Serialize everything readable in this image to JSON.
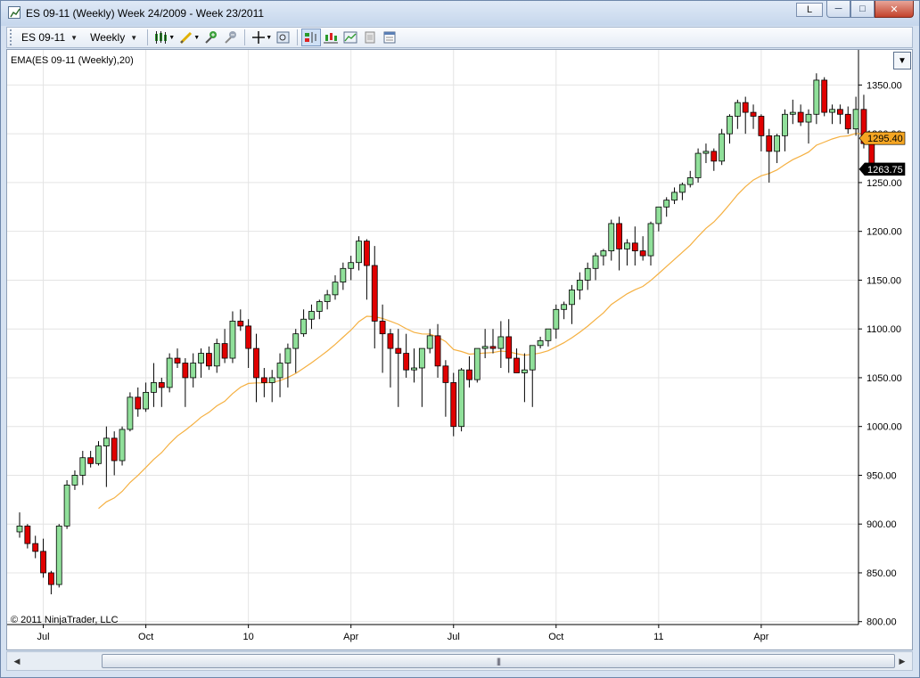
{
  "window": {
    "title": "ES 09-11 (Weekly)  Week 24/2009 - Week 23/2011",
    "lock_label": "L"
  },
  "toolbar": {
    "instrument": "ES 09-11",
    "period": "Weekly",
    "icons": [
      "bar-style-icon",
      "drawing-tool-icon",
      "zoom-in-icon",
      "zoom-out-icon",
      "crosshair-icon",
      "data-box-icon",
      "chart-trader-icon",
      "indicators-icon",
      "strategies-icon",
      "properties-icon",
      "tabs-icon"
    ]
  },
  "chart": {
    "indicator_label": "EMA(ES 09-11 (Weekly),20)",
    "copyright": "© 2011 NinjaTrader, LLC",
    "colors": {
      "up": "#90e09a",
      "down": "#e00000",
      "ema": "#f5b041",
      "grid": "#e4e4e4",
      "ema_tag": "#f5a623",
      "price_tag": "#000000"
    }
  },
  "chart_data": {
    "type": "candlestick",
    "y_ticks": [
      "1350.00",
      "1300.00",
      "1250.00",
      "1200.00",
      "1150.00",
      "1100.00",
      "1050.00",
      "1000.00",
      "950.00",
      "900.00",
      "850.00",
      "800.00"
    ],
    "ylim": [
      797,
      1386
    ],
    "x_ticks": [
      {
        "label": "Jul",
        "index": 3
      },
      {
        "label": "Oct",
        "index": 16
      },
      {
        "label": "10",
        "index": 29
      },
      {
        "label": "Apr",
        "index": 42
      },
      {
        "label": "Jul",
        "index": 55
      },
      {
        "label": "Oct",
        "index": 68
      },
      {
        "label": "11",
        "index": 81
      },
      {
        "label": "Apr",
        "index": 94
      }
    ],
    "ema_value": "1295.40",
    "last_price": "1263.75",
    "ema_start_index": 10,
    "candles": [
      [
        892,
        912,
        886,
        898
      ],
      [
        898,
        900,
        875,
        880
      ],
      [
        880,
        888,
        865,
        872
      ],
      [
        872,
        885,
        845,
        850
      ],
      [
        850,
        852,
        828,
        838
      ],
      [
        838,
        900,
        835,
        898
      ],
      [
        898,
        945,
        895,
        940
      ],
      [
        940,
        955,
        935,
        950
      ],
      [
        950,
        975,
        940,
        968
      ],
      [
        968,
        975,
        958,
        962
      ],
      [
        962,
        985,
        960,
        980
      ],
      [
        980,
        1000,
        938,
        988
      ],
      [
        988,
        995,
        950,
        965
      ],
      [
        965,
        1000,
        960,
        997
      ],
      [
        997,
        1035,
        995,
        1030
      ],
      [
        1030,
        1040,
        1010,
        1018
      ],
      [
        1018,
        1045,
        1015,
        1035
      ],
      [
        1035,
        1065,
        1020,
        1045
      ],
      [
        1045,
        1050,
        1020,
        1040
      ],
      [
        1040,
        1075,
        1035,
        1070
      ],
      [
        1070,
        1080,
        1060,
        1065
      ],
      [
        1065,
        1070,
        1020,
        1050
      ],
      [
        1050,
        1075,
        1040,
        1065
      ],
      [
        1065,
        1080,
        1050,
        1075
      ],
      [
        1075,
        1082,
        1058,
        1062
      ],
      [
        1062,
        1090,
        1055,
        1085
      ],
      [
        1085,
        1100,
        1065,
        1070
      ],
      [
        1070,
        1118,
        1065,
        1108
      ],
      [
        1108,
        1120,
        1098,
        1103
      ],
      [
        1103,
        1110,
        1060,
        1080
      ],
      [
        1080,
        1095,
        1025,
        1050
      ],
      [
        1050,
        1060,
        1030,
        1045
      ],
      [
        1045,
        1058,
        1025,
        1050
      ],
      [
        1050,
        1075,
        1030,
        1065
      ],
      [
        1065,
        1085,
        1040,
        1080
      ],
      [
        1080,
        1100,
        1055,
        1095
      ],
      [
        1095,
        1120,
        1092,
        1110
      ],
      [
        1110,
        1125,
        1100,
        1118
      ],
      [
        1118,
        1130,
        1110,
        1128
      ],
      [
        1128,
        1140,
        1120,
        1135
      ],
      [
        1135,
        1155,
        1130,
        1148
      ],
      [
        1148,
        1168,
        1140,
        1162
      ],
      [
        1162,
        1175,
        1150,
        1168
      ],
      [
        1168,
        1195,
        1160,
        1190
      ],
      [
        1190,
        1192,
        1130,
        1165
      ],
      [
        1165,
        1185,
        1080,
        1108
      ],
      [
        1108,
        1125,
        1055,
        1095
      ],
      [
        1095,
        1100,
        1040,
        1080
      ],
      [
        1080,
        1100,
        1020,
        1075
      ],
      [
        1075,
        1095,
        1050,
        1058
      ],
      [
        1058,
        1080,
        1045,
        1060
      ],
      [
        1060,
        1080,
        1020,
        1080
      ],
      [
        1080,
        1100,
        1075,
        1093
      ],
      [
        1093,
        1105,
        1050,
        1062
      ],
      [
        1062,
        1068,
        1010,
        1045
      ],
      [
        1045,
        1055,
        990,
        1000
      ],
      [
        1000,
        1060,
        995,
        1058
      ],
      [
        1058,
        1072,
        1040,
        1048
      ],
      [
        1048,
        1080,
        1045,
        1080
      ],
      [
        1080,
        1100,
        1070,
        1082
      ],
      [
        1082,
        1100,
        1075,
        1080
      ],
      [
        1080,
        1108,
        1060,
        1092
      ],
      [
        1092,
        1110,
        1055,
        1070
      ],
      [
        1070,
        1080,
        1055,
        1055
      ],
      [
        1055,
        1075,
        1025,
        1058
      ],
      [
        1058,
        1080,
        1020,
        1083
      ],
      [
        1083,
        1092,
        1080,
        1088
      ],
      [
        1088,
        1100,
        1082,
        1100
      ],
      [
        1100,
        1125,
        1090,
        1120
      ],
      [
        1120,
        1128,
        1110,
        1125
      ],
      [
        1125,
        1145,
        1105,
        1140
      ],
      [
        1140,
        1158,
        1130,
        1150
      ],
      [
        1150,
        1168,
        1140,
        1162
      ],
      [
        1162,
        1178,
        1150,
        1175
      ],
      [
        1175,
        1182,
        1165,
        1180
      ],
      [
        1180,
        1212,
        1170,
        1208
      ],
      [
        1208,
        1215,
        1160,
        1182
      ],
      [
        1182,
        1192,
        1165,
        1188
      ],
      [
        1188,
        1205,
        1165,
        1180
      ],
      [
        1180,
        1195,
        1170,
        1175
      ],
      [
        1175,
        1210,
        1165,
        1208
      ],
      [
        1208,
        1225,
        1200,
        1225
      ],
      [
        1225,
        1235,
        1215,
        1232
      ],
      [
        1232,
        1245,
        1228,
        1240
      ],
      [
        1240,
        1250,
        1232,
        1248
      ],
      [
        1248,
        1262,
        1245,
        1255
      ],
      [
        1255,
        1285,
        1250,
        1280
      ],
      [
        1280,
        1290,
        1270,
        1282
      ],
      [
        1282,
        1285,
        1262,
        1272
      ],
      [
        1272,
        1305,
        1268,
        1300
      ],
      [
        1300,
        1320,
        1290,
        1318
      ],
      [
        1318,
        1335,
        1305,
        1332
      ],
      [
        1332,
        1338,
        1300,
        1322
      ],
      [
        1322,
        1330,
        1305,
        1318
      ],
      [
        1318,
        1320,
        1282,
        1298
      ],
      [
        1298,
        1305,
        1250,
        1282
      ],
      [
        1282,
        1300,
        1270,
        1298
      ],
      [
        1298,
        1325,
        1282,
        1320
      ],
      [
        1320,
        1335,
        1310,
        1322
      ],
      [
        1322,
        1330,
        1308,
        1312
      ],
      [
        1312,
        1325,
        1290,
        1320
      ],
      [
        1320,
        1362,
        1310,
        1355
      ],
      [
        1355,
        1358,
        1318,
        1322
      ],
      [
        1322,
        1330,
        1310,
        1325
      ],
      [
        1325,
        1330,
        1310,
        1320
      ],
      [
        1320,
        1328,
        1300,
        1305
      ],
      [
        1305,
        1338,
        1298,
        1325
      ],
      [
        1325,
        1340,
        1285,
        1290
      ],
      [
        1290,
        1292,
        1260,
        1265
      ]
    ]
  }
}
